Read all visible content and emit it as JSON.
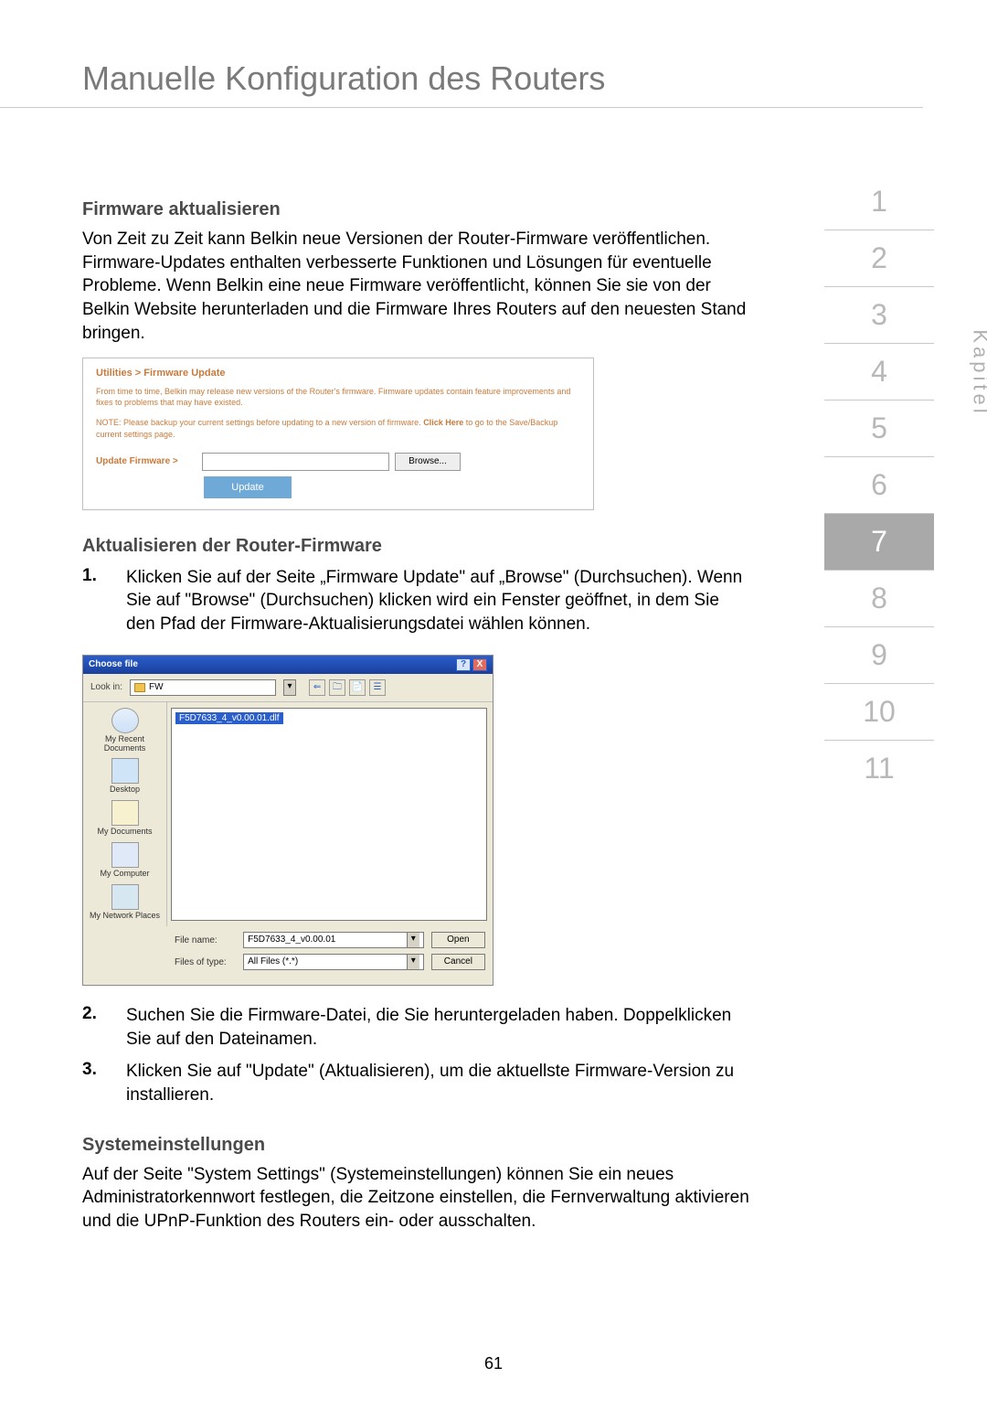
{
  "page_title": "Manuelle Konfiguration des Routers",
  "page_number": "61",
  "sectionA": {
    "heading": "Firmware aktualisieren",
    "para": "Von Zeit zu Zeit kann Belkin neue Versionen der Router-Firmware veröffentlichen. Firmware-Updates enthalten verbesserte Funktionen und Lösungen für eventuelle Probleme. Wenn Belkin eine neue Firmware veröffentlicht, können Sie sie von der Belkin Website herunterladen und die Firmware Ihres Routers auf den neuesten Stand bringen."
  },
  "panel1": {
    "breadcrumb": "Utilities > Firmware Update",
    "note1": "From time to time, Belkin may release new versions of the Router's firmware. Firmware updates contain feature improvements and fixes to problems that may have existed.",
    "note2_pre": "NOTE: Please backup your current settings before updating to a new version of firmware. ",
    "note2_link": "Click Here",
    "note2_post": " to go to the Save/Backup current settings page.",
    "update_label": "Update Firmware >",
    "browse_btn": "Browse...",
    "update_btn": "Update"
  },
  "sectionB": {
    "heading": "Aktualisieren der Router-Firmware",
    "step1_num": "1.",
    "step1": "Klicken Sie auf der Seite  „Firmware Update\" auf „Browse\" (Durchsuchen). Wenn Sie auf \"Browse\" (Durchsuchen) klicken wird ein Fenster geöffnet, in dem Sie den Pfad der Firmware-Aktualisierungsdatei wählen können.",
    "step2_num": "2.",
    "step2": "Suchen Sie die Firmware-Datei, die Sie heruntergeladen haben. Doppelklicken Sie auf den Dateinamen.",
    "step3_num": "3.",
    "step3": "Klicken Sie auf \"Update\" (Aktualisieren), um die aktuellste Firmware-Version zu installieren."
  },
  "dialog": {
    "title": "Choose file",
    "help_btn": "?",
    "close_btn": "X",
    "lookin_label": "Look in:",
    "lookin_value": "FW",
    "nav_back": "⇐",
    "nav_up": "🗀",
    "nav_new": "📄",
    "nav_views": "☰",
    "sidebar": {
      "recent": "My Recent Documents",
      "desktop": "Desktop",
      "docs": "My Documents",
      "comp": "My Computer",
      "net": "My Network Places"
    },
    "selected_file": "F5D7633_4_v0.00.01.dlf",
    "filename_label": "File name:",
    "filename_value": "F5D7633_4_v0.00.01",
    "filetype_label": "Files of type:",
    "filetype_value": "All Files (*.*)",
    "open_btn": "Open",
    "cancel_btn": "Cancel"
  },
  "sectionC": {
    "heading": "Systemeinstellungen",
    "para": "Auf der Seite \"System Settings\" (Systemeinstellungen) können Sie ein neues Administratorkennwort festlegen, die Zeitzone einstellen, die Fernverwaltung aktivieren und die UPnP-Funktion des Routers ein- oder ausschalten."
  },
  "chapters": {
    "label": "Kapitel",
    "items": [
      "1",
      "2",
      "3",
      "4",
      "5",
      "6",
      "7",
      "8",
      "9",
      "10",
      "11"
    ],
    "active": "7"
  }
}
